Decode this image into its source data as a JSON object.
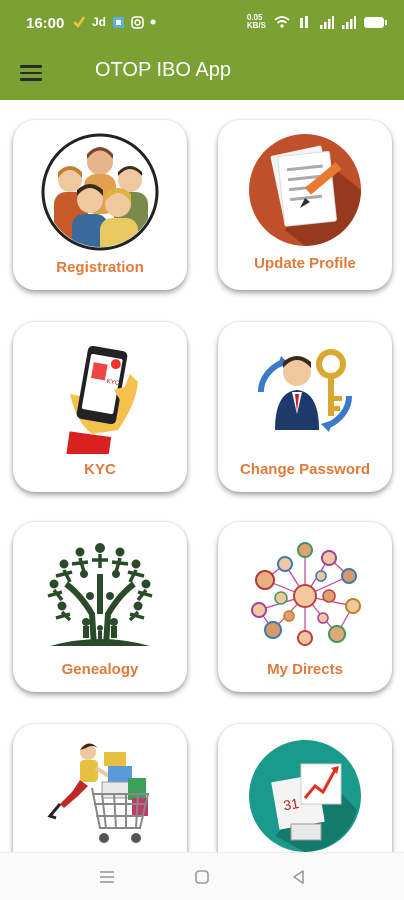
{
  "status_bar": {
    "time": "16:00",
    "left_icons": [
      "check-icon",
      "jd-icon",
      "shield-icon",
      "camera-icon",
      "dot-icon"
    ],
    "jd_text": "Jd",
    "data_speed": "0.05",
    "data_unit": "KB/S",
    "signal_icons": [
      "wifi-icon",
      "volte-icon",
      "signal-icon",
      "signal-icon"
    ],
    "battery_icon": "battery-icon"
  },
  "app_bar": {
    "menu_icon": "menu-icon",
    "title": "OTOP IBO App"
  },
  "tiles": [
    {
      "label": "Registration",
      "icon": "group-of-people-icon"
    },
    {
      "label": "Update Profile",
      "icon": "edit-document-icon"
    },
    {
      "label": "KYC",
      "icon": "phone-id-icon"
    },
    {
      "label": "Change Password",
      "icon": "businessman-key-icon"
    },
    {
      "label": "Genealogy",
      "icon": "tree-people-icon"
    },
    {
      "label": "My Directs",
      "icon": "network-people-icon"
    },
    {
      "label": "",
      "icon": "shopping-cart-icon"
    },
    {
      "label": "",
      "icon": "calendar-chart-icon"
    }
  ],
  "nav_bar": {
    "buttons": [
      "recent-apps-icon",
      "home-icon",
      "back-icon"
    ]
  },
  "colors": {
    "primary": "#7ba135",
    "label": "#e07a3a"
  }
}
